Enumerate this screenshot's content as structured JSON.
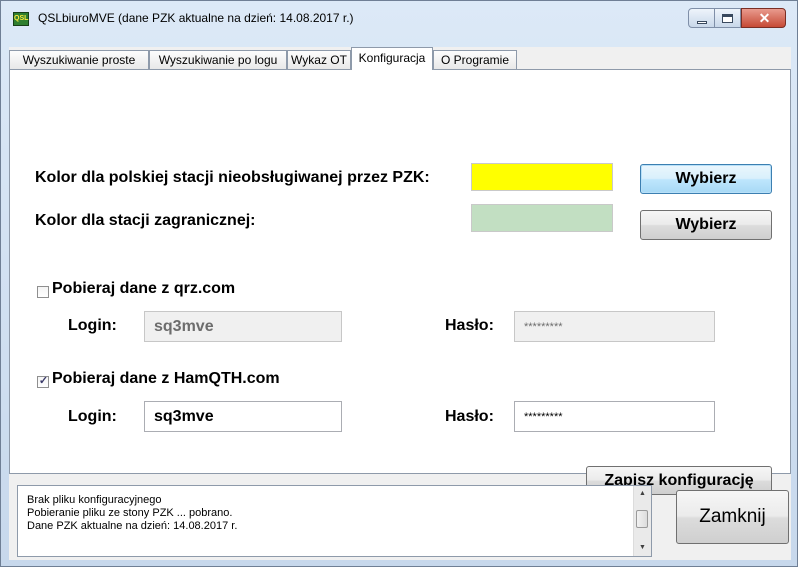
{
  "window": {
    "title": "QSLbiuroMVE (dane PZK aktualne na dzień: 14.08.2017 r.)",
    "icon": "qsl-app-icon",
    "icon_text": "QSL",
    "minimize_icon": "minimize-icon",
    "maximize_icon": "maximize-icon",
    "close_glyph": "✕"
  },
  "tabs": [
    {
      "label": "Wyszukiwanie proste"
    },
    {
      "label": "Wyszukiwanie po logu"
    },
    {
      "label": "Wykaz OT"
    },
    {
      "label": "Konfiguracja",
      "active": true
    },
    {
      "label": "O Programie"
    }
  ],
  "config": {
    "polish_color_label": "Kolor dla polskiej stacji nieobsługiwanej przez PZK:",
    "polish_color": "#ffff00",
    "foreign_color_label": "Kolor dla stacji zagranicznej:",
    "foreign_color": "#c2dfc2",
    "choose_label": "Wybierz",
    "qrz": {
      "checkbox_label": "Pobieraj dane z qrz.com",
      "checked": false,
      "login_label": "Login:",
      "login_value": "sq3mve",
      "password_label": "Hasło:",
      "password_value": "*********"
    },
    "hamqth": {
      "checkbox_label": "Pobieraj dane z HamQTH.com",
      "checked": true,
      "check_glyph": "✓",
      "login_label": "Login:",
      "login_value": "sq3mve",
      "password_label": "Hasło:",
      "password_value": "*********"
    },
    "save_label": "Zapisz konfigurację"
  },
  "log": {
    "lines": [
      "Brak pliku konfiguracyjnego",
      "Pobieranie pliku ze stony PZK ... pobrano.",
      "Dane PZK aktualne na dzień: 14.08.2017 r."
    ],
    "scroll_up": "▲",
    "scroll_down": "▼"
  },
  "close_button_label": "Zamknij"
}
